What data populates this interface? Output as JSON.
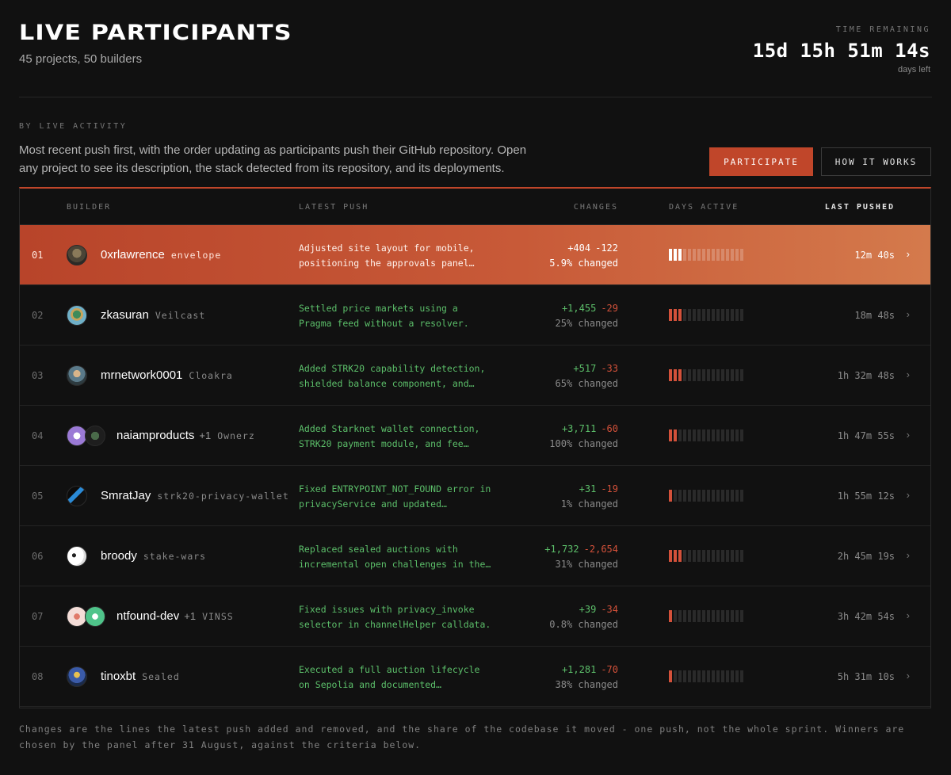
{
  "header": {
    "title": "LIVE PARTICIPANTS",
    "subtitle": "45 projects, 50 builders",
    "timer_label": "TIME REMAINING",
    "timer": "15d 15h 51m 14s",
    "timer_sub": "days left"
  },
  "intro": {
    "section_label": "BY LIVE ACTIVITY",
    "text": "Most recent push first, with the order updating as participants push their GitHub repository. Open any project to see its description, the stack detected from its repository, and its deployments.",
    "participate_label": "PARTICIPATE",
    "how_label": "HOW IT WORKS"
  },
  "table": {
    "headers": {
      "builder": "BUILDER",
      "latest_push": "LATEST PUSH",
      "changes": "CHANGES",
      "days_active": "DAYS ACTIVE",
      "last_pushed": "LAST PUSHED"
    },
    "rows": [
      {
        "rank": "01",
        "builder": "0xrlawrence",
        "extra": "",
        "project": "envelope",
        "push1": "Adjusted site layout for mobile,",
        "push2": "positioning the approvals panel…",
        "added": "+404",
        "removed": "-122",
        "pct": "5.9% changed",
        "days_active": 3,
        "last": "12m 40s"
      },
      {
        "rank": "02",
        "builder": "zkasuran",
        "extra": "",
        "project": "Veilcast",
        "push1": "Settled price markets using a",
        "push2": "Pragma feed without a resolver.",
        "added": "+1,455",
        "removed": "-29",
        "pct": "25% changed",
        "days_active": 3,
        "last": "18m 48s"
      },
      {
        "rank": "03",
        "builder": "mrnetwork0001",
        "extra": "",
        "project": "Cloakra",
        "push1": "Added STRK20 capability detection,",
        "push2": "shielded balance component, and…",
        "added": "+517",
        "removed": "-33",
        "pct": "65% changed",
        "days_active": 3,
        "last": "1h 32m 48s"
      },
      {
        "rank": "04",
        "builder": "naiamproducts",
        "extra": "+1",
        "project": "Ownerz",
        "push1": "Added Starknet wallet connection,",
        "push2": "STRK20 payment module, and fee…",
        "added": "+3,711",
        "removed": "-60",
        "pct": "100% changed",
        "days_active": 2,
        "last": "1h 47m 55s"
      },
      {
        "rank": "05",
        "builder": "SmratJay",
        "extra": "",
        "project": "strk20-privacy-wallet",
        "push1": "Fixed ENTRYPOINT_NOT_FOUND error in",
        "push2": "privacyService and updated…",
        "added": "+31",
        "removed": "-19",
        "pct": "1% changed",
        "days_active": 1,
        "last": "1h 55m 12s"
      },
      {
        "rank": "06",
        "builder": "broody",
        "extra": "",
        "project": "stake-wars",
        "push1": "Replaced sealed auctions with",
        "push2": "incremental open challenges in the…",
        "added": "+1,732",
        "removed": "-2,654",
        "pct": "31% changed",
        "days_active": 3,
        "last": "2h 45m 19s"
      },
      {
        "rank": "07",
        "builder": "ntfound-dev",
        "extra": "+1",
        "project": "VINSS",
        "push1": "Fixed issues with privacy_invoke",
        "push2": "selector in channelHelper calldata.",
        "added": "+39",
        "removed": "-34",
        "pct": "0.8% changed",
        "days_active": 1,
        "last": "3h 42m 54s"
      },
      {
        "rank": "08",
        "builder": "tinoxbt",
        "extra": "",
        "project": "Sealed",
        "push1": "Executed a full auction lifecycle",
        "push2": "on Sepolia and documented…",
        "added": "+1,281",
        "removed": "-70",
        "pct": "38% changed",
        "days_active": 1,
        "last": "5h 31m 10s"
      }
    ],
    "days_total": 16
  },
  "footnote": "Changes are the lines the latest push added and removed, and the share of the codebase it moved - one push, not the whole sprint. Winners are chosen by the panel after 31 August, against the criteria below.",
  "colors": {
    "accent": "#c0462a",
    "added": "#5cbf6a",
    "removed": "#d4513a",
    "background": "#111111"
  }
}
